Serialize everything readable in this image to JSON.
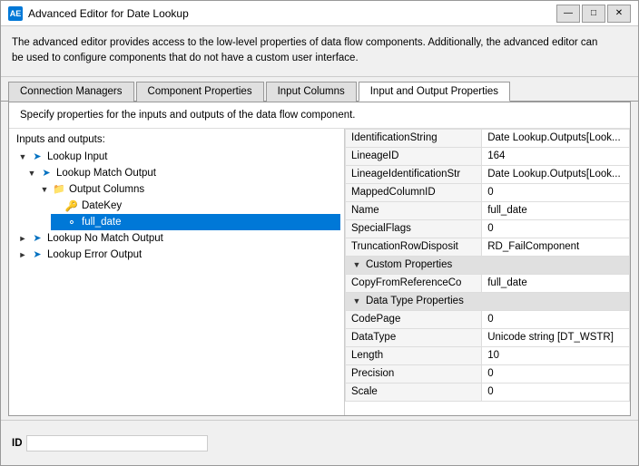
{
  "window": {
    "title": "Advanced Editor for Date Lookup",
    "icon": "AE"
  },
  "description": {
    "line1": "The advanced editor provides access to the low-level properties of data flow components. Additionally, the advanced editor can",
    "line2": "be used to configure components that do not have a custom user interface."
  },
  "tabs": [
    {
      "label": "Connection Managers",
      "active": false
    },
    {
      "label": "Component Properties",
      "active": false
    },
    {
      "label": "Input Columns",
      "active": false
    },
    {
      "label": "Input and Output Properties",
      "active": true
    }
  ],
  "content_description": "Specify properties for the inputs and outputs of the data flow component.",
  "tree": {
    "section_label": "Inputs and outputs:",
    "items": [
      {
        "id": "lookup-input",
        "label": "Lookup Input",
        "indent": 0,
        "expanded": true,
        "type": "arrow",
        "selected": false
      },
      {
        "id": "lookup-match-output",
        "label": "Lookup Match Output",
        "indent": 1,
        "expanded": true,
        "type": "arrow",
        "selected": false
      },
      {
        "id": "output-columns",
        "label": "Output Columns",
        "indent": 2,
        "expanded": true,
        "type": "folder",
        "selected": false
      },
      {
        "id": "datekey",
        "label": "DateKey",
        "indent": 3,
        "expanded": false,
        "type": "key",
        "selected": false
      },
      {
        "id": "full-date",
        "label": "full_date",
        "indent": 3,
        "expanded": false,
        "type": "field",
        "selected": true
      },
      {
        "id": "lookup-no-match",
        "label": "Lookup No Match Output",
        "indent": 0,
        "expanded": false,
        "type": "arrow",
        "selected": false
      },
      {
        "id": "lookup-error",
        "label": "Lookup Error Output",
        "indent": 0,
        "expanded": false,
        "type": "arrow",
        "selected": false
      }
    ]
  },
  "properties": [
    {
      "name": "IdentificationString",
      "value": "Date Lookup.Outputs[Look...",
      "truncated": true
    },
    {
      "name": "LineageID",
      "value": "164"
    },
    {
      "name": "LineageIdentificationStr",
      "value": "Date Lookup.Outputs[Look...",
      "truncated": true
    },
    {
      "name": "MappedColumnID",
      "value": "0"
    },
    {
      "name": "Name",
      "value": "full_date"
    },
    {
      "name": "SpecialFlags",
      "value": "0"
    },
    {
      "name": "TruncationRowDisposit",
      "value": "RD_FailComponent"
    }
  ],
  "sections": [
    {
      "label": "Custom Properties",
      "collapsed": false,
      "items": [
        {
          "name": "CopyFromReferenceCo",
          "value": "full_date"
        }
      ]
    },
    {
      "label": "Data Type Properties",
      "collapsed": false,
      "items": [
        {
          "name": "CodePage",
          "value": "0"
        },
        {
          "name": "DataType",
          "value": "Unicode string [DT_WSTR]"
        },
        {
          "name": "Length",
          "value": "10"
        },
        {
          "name": "Precision",
          "value": "0"
        },
        {
          "name": "Scale",
          "value": "0"
        }
      ]
    }
  ],
  "bottom": {
    "id_label": "ID",
    "id_value": ""
  },
  "buttons": {
    "minimize": "—",
    "maximize": "□",
    "close": "✕"
  }
}
